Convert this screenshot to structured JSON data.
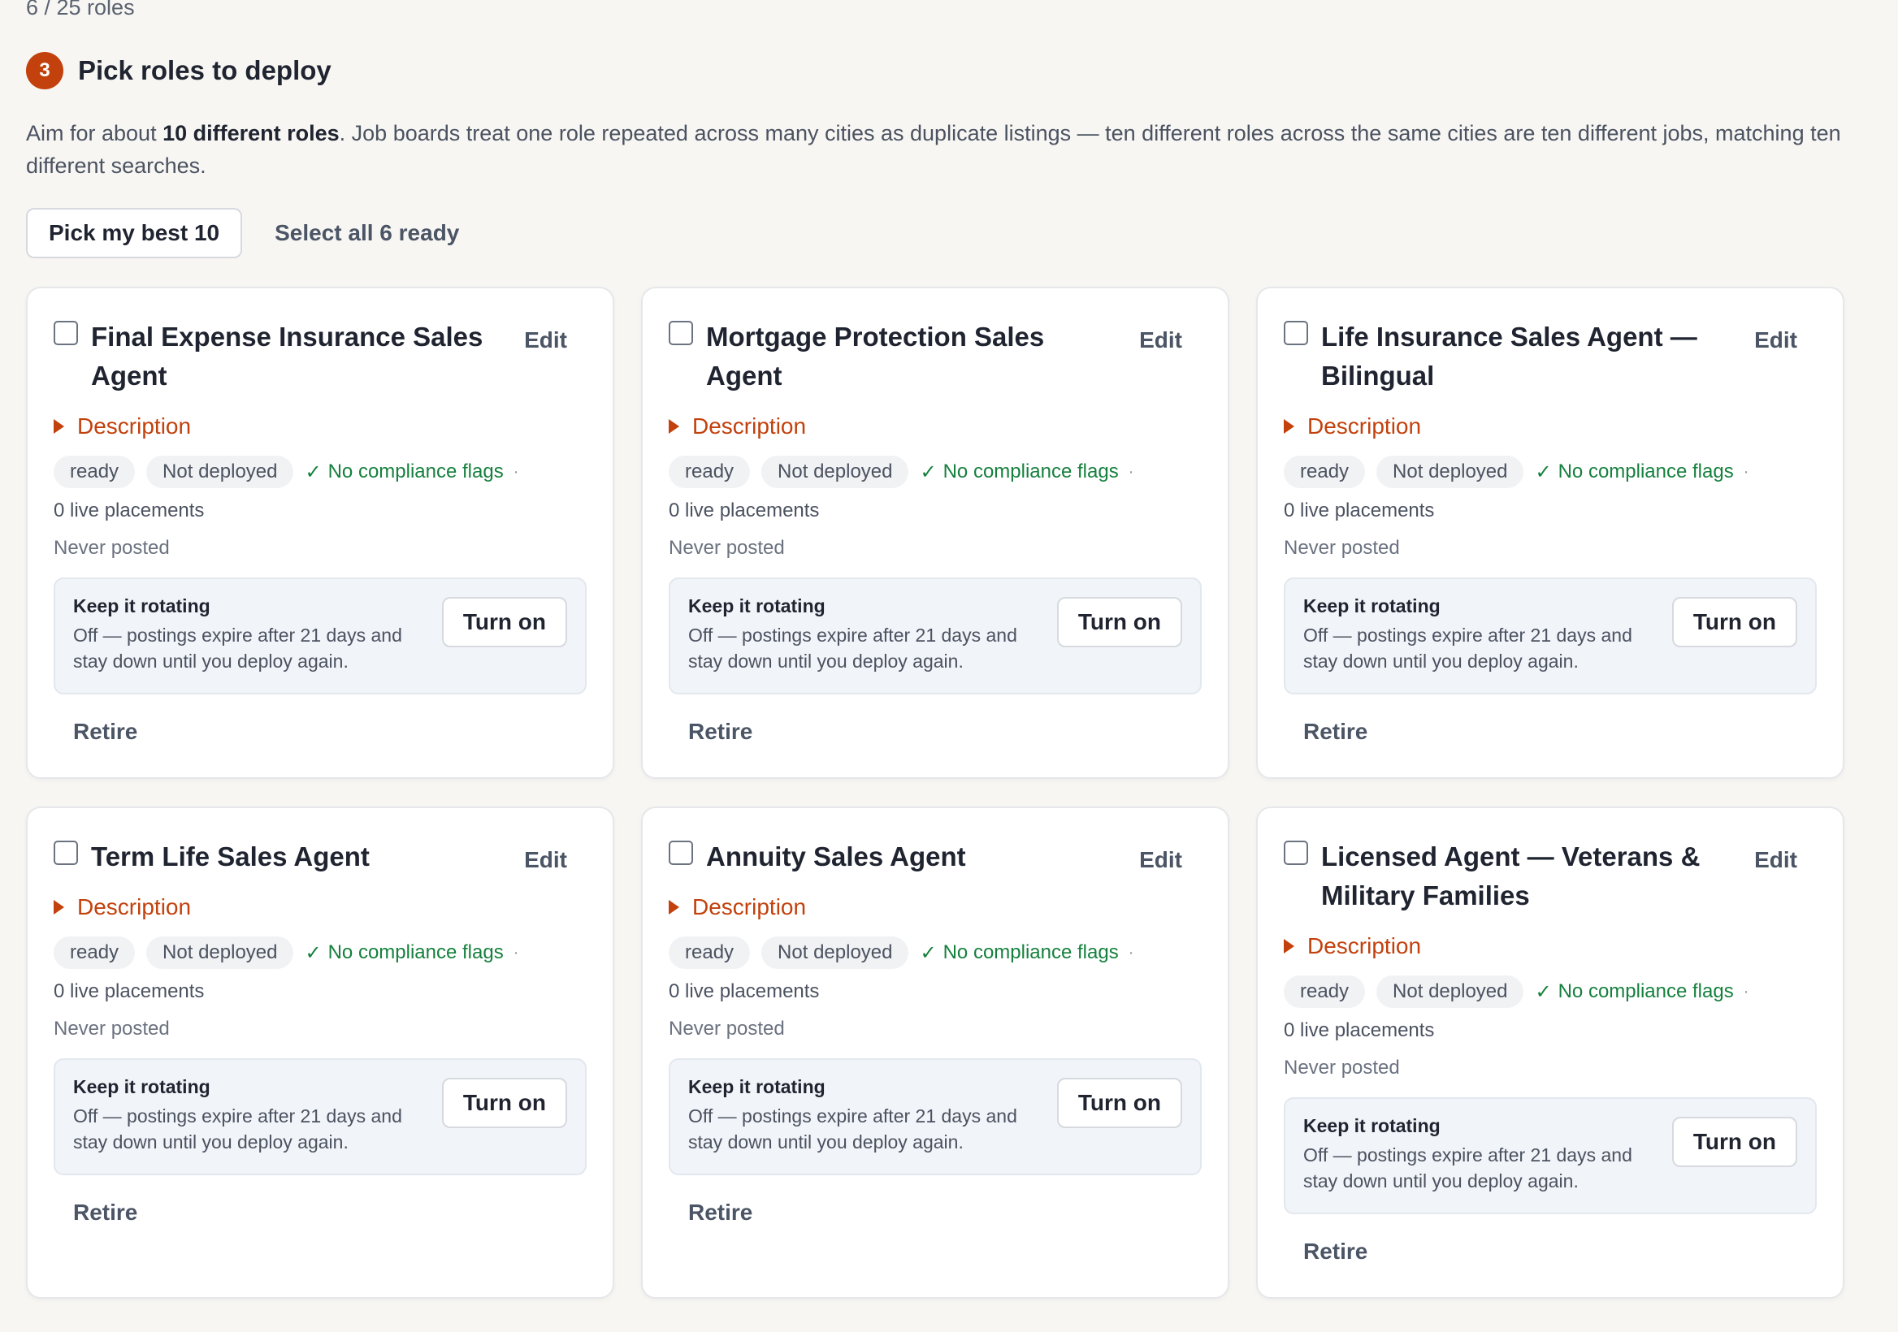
{
  "header": {
    "roles_count": "6 / 25 roles",
    "step_number": "3",
    "step_title": "Pick roles to deploy",
    "intro_pre": "Aim for about ",
    "intro_bold": "10 different roles",
    "intro_post": ". Job boards treat one role repeated across many cities as duplicate listings — ten different roles across the same cities are ten different jobs, matching ten different searches."
  },
  "actions": {
    "pick_best_label": "Pick my best 10",
    "select_all_label": "Select all 6 ready"
  },
  "card_labels": {
    "edit": "Edit",
    "description": "Description",
    "ready": "ready",
    "not_deployed": "Not deployed",
    "check_glyph": "✓",
    "compliance": "No compliance flags",
    "dot": "·",
    "placements": "0 live placements",
    "never_posted": "Never posted",
    "rotate_title": "Keep it rotating",
    "rotate_text": "Off — postings expire after 21 days and stay down until you deploy again.",
    "turn_on": "Turn on",
    "retire": "Retire"
  },
  "roles": [
    {
      "title": "Final Expense Insurance Sales Agent"
    },
    {
      "title": "Mortgage Protection Sales Agent"
    },
    {
      "title": "Life Insurance Sales Agent — Bilingual"
    },
    {
      "title": "Term Life Sales Agent"
    },
    {
      "title": "Annuity Sales Agent"
    },
    {
      "title": "Licensed Agent — Veterans & Military Families"
    }
  ],
  "colors": {
    "accent": "#c2410c",
    "success": "#15803d",
    "background": "#f7f6f3"
  }
}
